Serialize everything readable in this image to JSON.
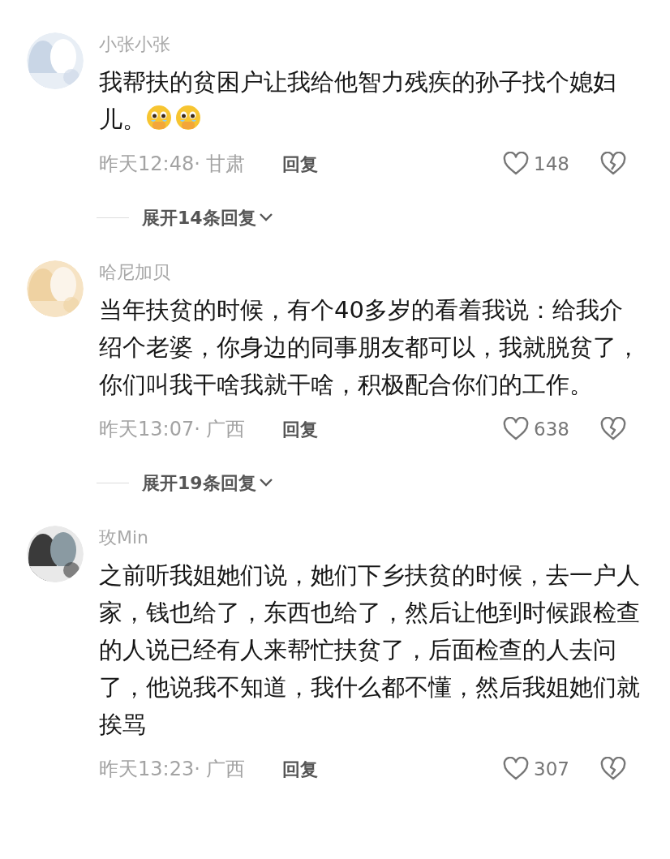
{
  "comments": [
    {
      "username": "小张小张",
      "text": "我帮扶的贫困户让我给他智力残疾的孙子找个媳妇儿。",
      "emojis": [
        {
          "kind": "teary"
        },
        {
          "kind": "teary"
        }
      ],
      "time": "昨天12:48· 甘肃",
      "reply": "回复",
      "likes": "148",
      "liked": false,
      "replies_toggle": "展开14条回复"
    },
    {
      "username": "哈尼加贝",
      "text": "当年扶贫的时候，有个40多岁的看着我说：给我介绍个老婆，你身边的同事朋友都可以，我就脱贫了，你们叫我干啥我就干啥，积极配合你们的工作。",
      "time": "昨天13:07· 广西",
      "reply": "回复",
      "likes": "638",
      "liked": false,
      "replies_toggle": "展开19条回复"
    },
    {
      "username": "玫Min",
      "text": "之前听我姐她们说，她们下乡扶贫的时候，去一户人家，钱也给了，东西也给了，然后让他到时候跟检查的人说已经有人来帮忙扶贫了，后面检查的人去问了，他说我不知道，我什么都不懂，然后我姐她们就挨骂",
      "time": "昨天13:23· 广西",
      "reply": "回复",
      "likes": "307",
      "liked": false
    }
  ]
}
